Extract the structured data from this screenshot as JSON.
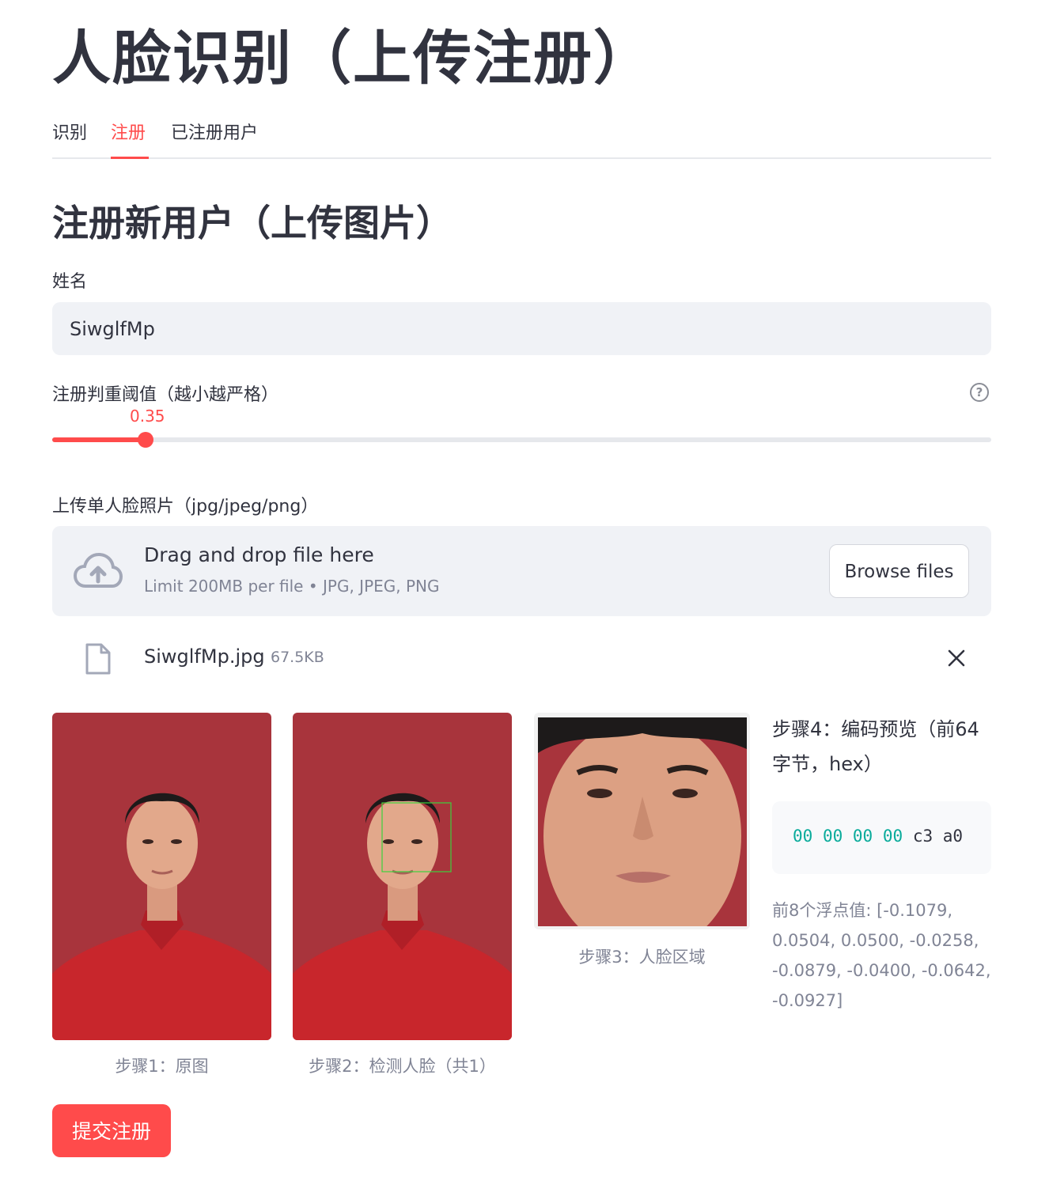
{
  "app_title": "人脸识别（上传注册）",
  "tabs": [
    {
      "label": "识别",
      "active": false
    },
    {
      "label": "注册",
      "active": true
    },
    {
      "label": "已注册用户",
      "active": false
    }
  ],
  "section_title": "注册新用户（上传图片）",
  "name_field": {
    "label": "姓名",
    "value": "SiwglfMp"
  },
  "threshold": {
    "label": "注册判重阈值（越小越严格）",
    "value": "0.35",
    "min": 0,
    "max": 1,
    "help_icon": "question-circle-icon"
  },
  "upload": {
    "label": "上传单人脸照片（jpg/jpeg/png）",
    "drop_title": "Drag and drop file here",
    "drop_limit": "Limit 200MB per file • JPG, JPEG, PNG",
    "browse_label": "Browse files",
    "icon": "cloud-upload-icon"
  },
  "uploaded_file": {
    "name": "SiwglfMp.jpg",
    "size": "67.5KB",
    "icon": "file-icon",
    "remove_icon": "close-icon"
  },
  "steps": {
    "step1_caption": "步骤1：原图",
    "step2_caption": "步骤2：检测人脸（共1）",
    "step3_caption": "步骤3：人脸区域",
    "step4_title": "步骤4：编码预览（前64字节，hex）",
    "hex_preview": [
      "00",
      "00",
      "00",
      "00",
      "c3",
      "a0"
    ],
    "floats_text": "前8个浮点值: [-0.1079, 0.0504, 0.0500, -0.0258, -0.0879, -0.0400, -0.0642, -0.0927]"
  },
  "submit_label": "提交注册",
  "colors": {
    "accent": "#ff4b4b",
    "input_bg": "#f0f2f6",
    "photo_bg": "#a8343c",
    "shirt": "#c8262c",
    "face_box": "#3cd23c",
    "hex_zero": "#09ab9b"
  }
}
